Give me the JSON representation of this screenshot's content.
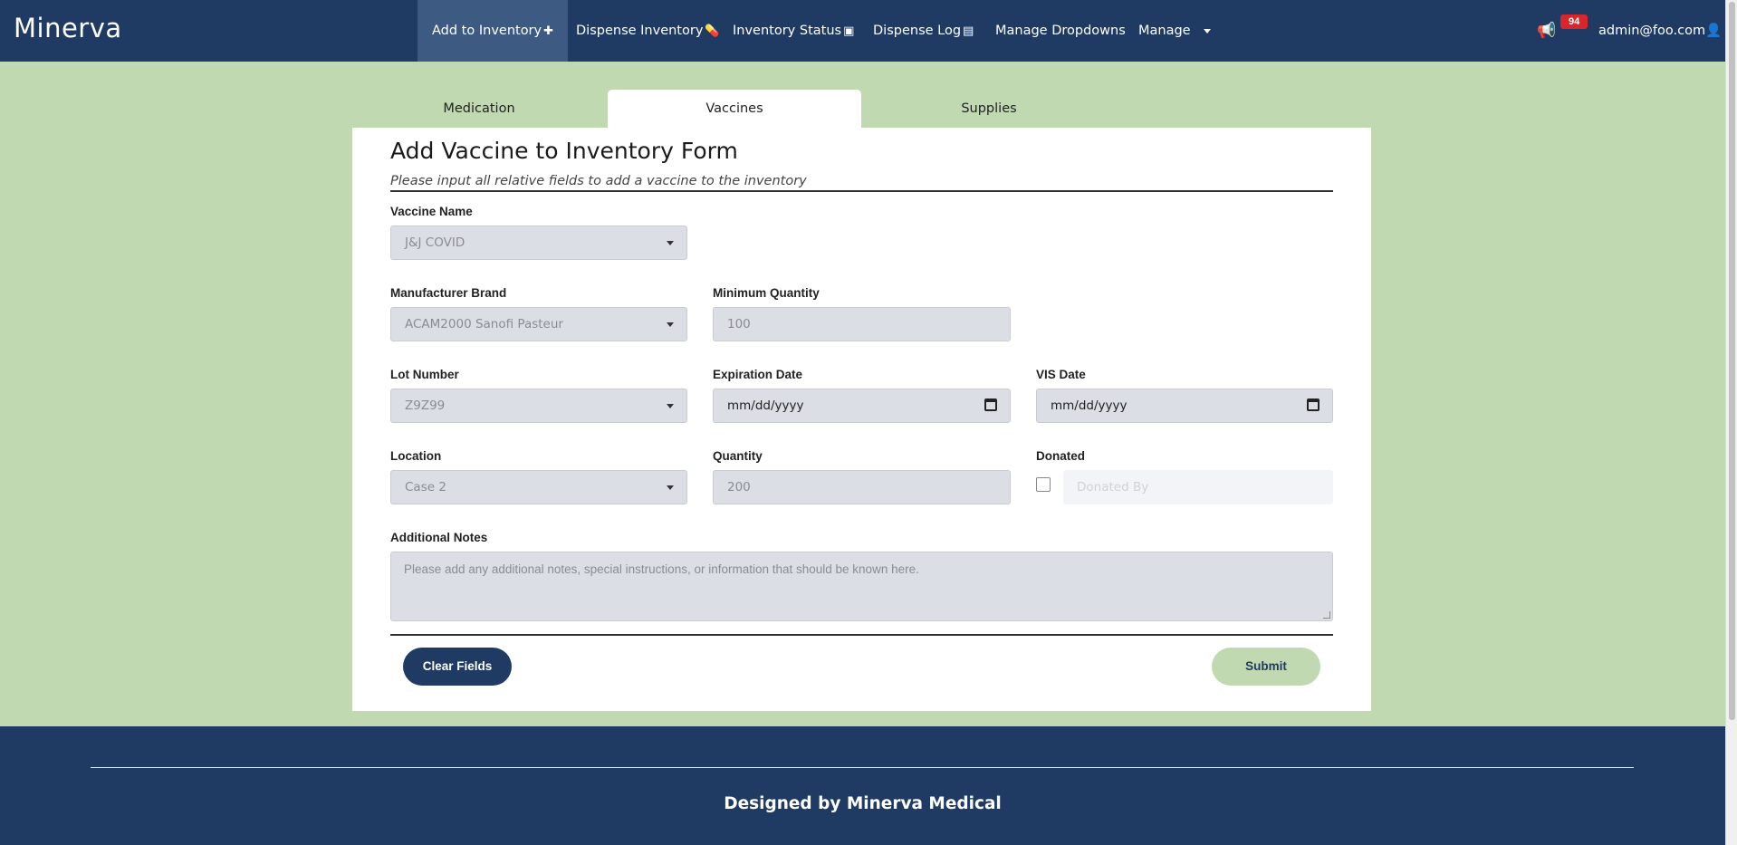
{
  "navbar": {
    "brand": "Minerva",
    "items": [
      {
        "label": "Add to Inventory",
        "icon": "plus-icon"
      },
      {
        "label": "Dispense Inventory",
        "icon": "pills-icon"
      },
      {
        "label": "Inventory Status",
        "icon": "archive-icon"
      },
      {
        "label": "Dispense Log",
        "icon": "book-icon"
      },
      {
        "label": "Manage Dropdowns"
      },
      {
        "label": "Manage"
      }
    ],
    "notification_count": "94",
    "user_email": "admin@foo.com"
  },
  "tabs": [
    "Medication",
    "Vaccines",
    "Supplies"
  ],
  "active_tab": "Vaccines",
  "form": {
    "title": "Add Vaccine to Inventory Form",
    "subtitle": "Please input all relative fields to add a vaccine to the inventory",
    "vaccine_name": {
      "label": "Vaccine Name",
      "value": "J&J COVID"
    },
    "manufacturer_brand": {
      "label": "Manufacturer Brand",
      "value": "ACAM2000 Sanofi Pasteur"
    },
    "minimum_quantity": {
      "label": "Minimum Quantity",
      "value": "100"
    },
    "lot_number": {
      "label": "Lot Number",
      "value": "Z9Z99"
    },
    "expiration_date": {
      "label": "Expiration Date",
      "value": "mm/dd/yyyy"
    },
    "vis_date": {
      "label": "VIS Date",
      "value": "mm/dd/yyyy"
    },
    "location": {
      "label": "Location",
      "value": "Case 2"
    },
    "quantity": {
      "label": "Quantity",
      "value": "200"
    },
    "donated": {
      "label": "Donated",
      "checked": false,
      "donated_by_placeholder": "Donated By"
    },
    "additional_notes": {
      "label": "Additional Notes",
      "placeholder": "Please add any additional notes, special instructions, or information that should be known here."
    },
    "clear_button": "Clear Fields",
    "submit_button": "Submit"
  },
  "footer": {
    "text": "Designed by Minerva Medical"
  },
  "colors": {
    "navy": "#1f3b64",
    "sage": "#c1d9b1",
    "badge_red": "#d9262b"
  }
}
